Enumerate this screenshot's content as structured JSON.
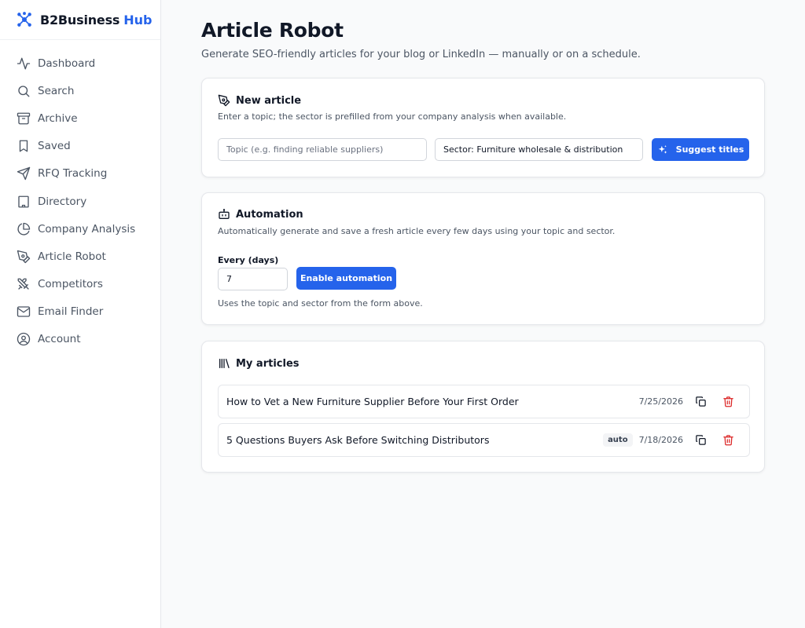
{
  "brand": {
    "name": "B2Business",
    "accent": "Hub"
  },
  "colors": {
    "accent": "#2563eb",
    "danger": "#dc2626",
    "text": "#111827",
    "muted": "#4b5563",
    "border": "#e5e7eb"
  },
  "sidebar": {
    "items": [
      {
        "label": "Dashboard",
        "icon": "activity-icon"
      },
      {
        "label": "Search",
        "icon": "search-icon"
      },
      {
        "label": "Archive",
        "icon": "archive-icon"
      },
      {
        "label": "Saved",
        "icon": "bookmark-icon"
      },
      {
        "label": "RFQ Tracking",
        "icon": "send-icon"
      },
      {
        "label": "Directory",
        "icon": "building-icon"
      },
      {
        "label": "Company Analysis",
        "icon": "pie-chart-icon"
      },
      {
        "label": "Article Robot",
        "icon": "pen-tool-icon"
      },
      {
        "label": "Competitors",
        "icon": "swords-icon"
      },
      {
        "label": "Email Finder",
        "icon": "mail-icon"
      },
      {
        "label": "Account",
        "icon": "user-circle-icon"
      }
    ]
  },
  "page": {
    "title": "Article Robot",
    "subtitle": "Generate SEO-friendly articles for your blog or LinkedIn — manually or on a schedule."
  },
  "new_article": {
    "title": "New article",
    "description": "Enter a topic; the sector is prefilled from your company analysis when available.",
    "topic_placeholder": "Topic (e.g. finding reliable suppliers)",
    "sector_value": "Sector: Furniture wholesale & distribution",
    "suggest_label": "Suggest titles"
  },
  "automation": {
    "title": "Automation",
    "description": "Automatically generate and save a fresh article every few days using your topic and sector.",
    "every_label": "Every (days)",
    "every_value": "7",
    "enable_label": "Enable automation",
    "hint": "Uses the topic and sector from the form above."
  },
  "articles": {
    "title": "My articles",
    "items": [
      {
        "title": "How to Vet a New Furniture Supplier Before Your First Order",
        "badge": "",
        "date": "7/25/2026"
      },
      {
        "title": "5 Questions Buyers Ask Before Switching Distributors",
        "badge": "auto",
        "date": "7/18/2026"
      }
    ]
  }
}
